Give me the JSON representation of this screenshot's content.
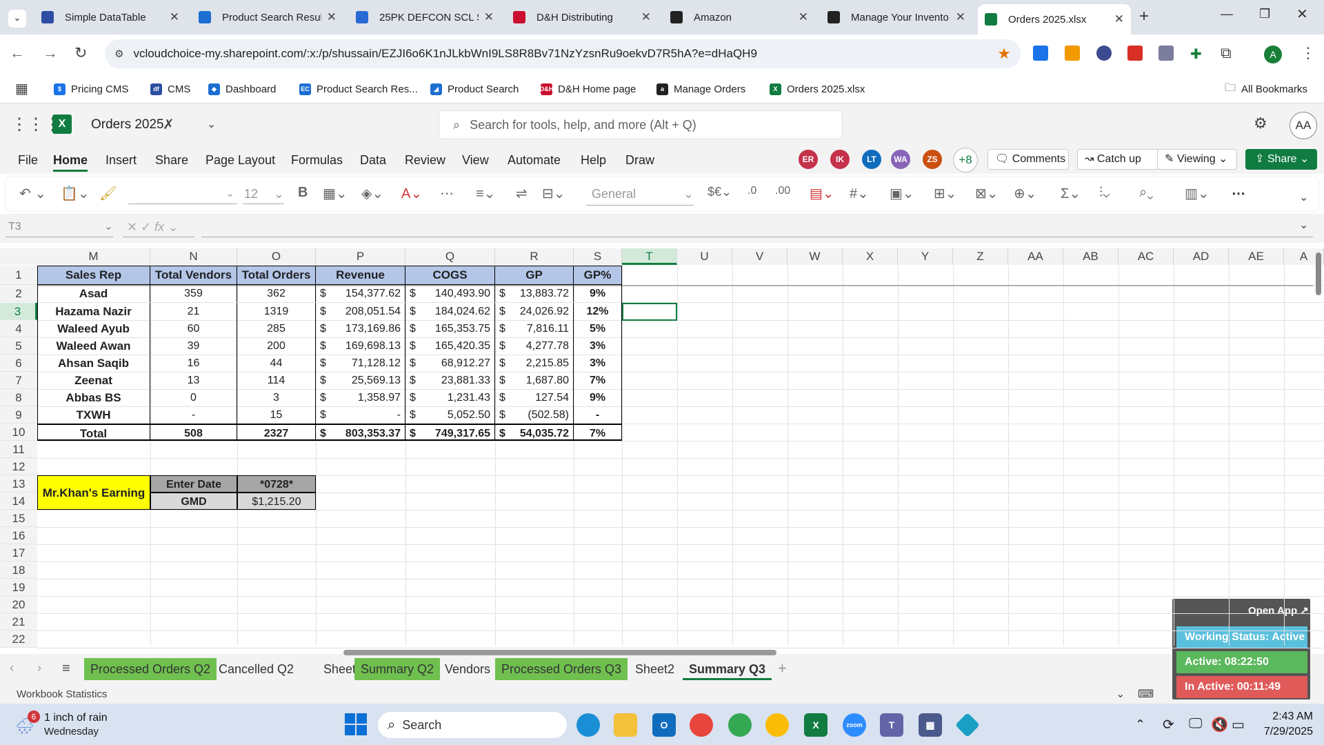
{
  "browser": {
    "tabs": [
      {
        "title": "Simple DataTable",
        "icon": "datatable-icon",
        "color": "#2c4fa3"
      },
      {
        "title": "Product Search Resul",
        "icon": "ec-icon",
        "color": "#1c6fd1"
      },
      {
        "title": "25PK DEFCON SCL SL",
        "icon": "defcon-icon",
        "color": "#2a6ad4"
      },
      {
        "title": "D&H Distributing",
        "icon": "dh-icon",
        "color": "#c8102e"
      },
      {
        "title": "Amazon",
        "icon": "amazon-icon",
        "color": "#222222"
      },
      {
        "title": "Manage Your Invento",
        "icon": "amazon-icon",
        "color": "#222222"
      },
      {
        "title": "Orders 2025.xlsx",
        "icon": "excel-icon",
        "color": "#107c41"
      }
    ],
    "url": "vcloudchoice-my.sharepoint.com/:x:/p/shussain/EZJI6o6K1nJLkbWnI9LS8R8Bv71NzYzsnRu9oekvD7R5hA?e=dHaQH9",
    "bookmarks": [
      {
        "label": "Pricing CMS",
        "color": "#1a73e8",
        "glyph": "$"
      },
      {
        "label": "CMS",
        "color": "#2c4fa3",
        "glyph": "df"
      },
      {
        "label": "Dashboard",
        "color": "#1c6fd1",
        "glyph": "◆"
      },
      {
        "label": "Product Search Res...",
        "color": "#1c6fd1",
        "glyph": "EC"
      },
      {
        "label": "Product Search",
        "color": "#1c6fd1",
        "glyph": "◢"
      },
      {
        "label": "D&H Home page",
        "color": "#c8102e",
        "glyph": "D&H"
      },
      {
        "label": "Manage Orders",
        "color": "#222222",
        "glyph": "a"
      },
      {
        "label": "Orders 2025.xlsx",
        "color": "#107c41",
        "glyph": "X"
      }
    ],
    "all_bookmarks": "All Bookmarks",
    "profile": "A"
  },
  "excel": {
    "doc_title": "Orders 2025",
    "search_placeholder": "Search for tools, help, and more (Alt + Q)",
    "user_initials": "AA",
    "menu": [
      "File",
      "Home",
      "Insert",
      "Share",
      "Page Layout",
      "Formulas",
      "Data",
      "Review",
      "View",
      "Automate",
      "Help",
      "Draw"
    ],
    "active_menu": "Home",
    "collaborators": [
      {
        "initials": "ER",
        "color": "#c4314b"
      },
      {
        "initials": "IK",
        "color": "#c4314b"
      },
      {
        "initials": "LT",
        "color": "#0f6cbd"
      },
      {
        "initials": "WA",
        "color": "#8764b8"
      },
      {
        "initials": "ZS",
        "color": "#ca5010"
      }
    ],
    "more_collaborators": "+8",
    "comments_label": "Comments",
    "catchup_label": "Catch up",
    "viewing_label": "Viewing",
    "share_label": "Share",
    "font_size": "12",
    "number_format": "General",
    "name_box": "T3",
    "sheet_columns": [
      "M",
      "N",
      "O",
      "P",
      "Q",
      "R",
      "S",
      "T",
      "U",
      "V",
      "W",
      "X",
      "Y",
      "Z",
      "AA",
      "AB",
      "AC",
      "AD",
      "AE",
      "A"
    ],
    "row_numbers": [
      "1",
      "2",
      "3",
      "4",
      "5",
      "6",
      "7",
      "8",
      "9",
      "10",
      "11",
      "12",
      "13",
      "14",
      "15",
      "16",
      "17",
      "18",
      "19",
      "20",
      "21",
      "22"
    ],
    "table": {
      "headers": [
        "Sales Rep",
        "Total Vendors",
        "Total Orders",
        "Revenue",
        "COGS",
        "GP",
        "GP%"
      ],
      "rows": [
        [
          "Asad",
          "359",
          "362",
          "154,377.62",
          "140,493.90",
          "13,883.72",
          "9%"
        ],
        [
          "Hazama Nazir",
          "21",
          "1319",
          "208,051.54",
          "184,024.62",
          "24,026.92",
          "12%"
        ],
        [
          "Waleed Ayub",
          "60",
          "285",
          "173,169.86",
          "165,353.75",
          "7,816.11",
          "5%"
        ],
        [
          "Waleed Awan",
          "39",
          "200",
          "169,698.13",
          "165,420.35",
          "4,277.78",
          "3%"
        ],
        [
          "Ahsan Saqib",
          "16",
          "44",
          "71,128.12",
          "68,912.27",
          "2,215.85",
          "3%"
        ],
        [
          "Zeenat",
          "13",
          "114",
          "25,569.13",
          "23,881.33",
          "1,687.80",
          "7%"
        ],
        [
          "Abbas BS",
          "0",
          "3",
          "1,358.97",
          "1,231.43",
          "127.54",
          "9%"
        ],
        [
          "TXWH",
          "-",
          "15",
          "-",
          "5,052.50",
          "(502.58)",
          "-"
        ]
      ],
      "total": [
        "Total",
        "508",
        "2327",
        "803,353.37",
        "749,317.65",
        "54,035.72",
        "7%"
      ],
      "currency_symbol": "$"
    },
    "earnings": {
      "label": "Mr.Khan's Earning",
      "date_label": "Enter Date",
      "date_value": "*0728*",
      "gmd_label": "GMD",
      "gmd_value": "$1,215.20"
    },
    "sheet_tabs": [
      {
        "label": "Processed Orders Q2",
        "color": "#70c050"
      },
      {
        "label": "Cancelled Q2",
        "color": ""
      },
      {
        "label": "Sheet1",
        "color": ""
      },
      {
        "label": "Summary Q2",
        "color": "#70c050"
      },
      {
        "label": "Vendors",
        "color": ""
      },
      {
        "label": "Processed Orders Q3",
        "color": "#70c050"
      },
      {
        "label": "Sheet2",
        "color": ""
      },
      {
        "label": "Summary Q3",
        "color": "",
        "active": true
      }
    ],
    "status_left": "Workbook Statistics"
  },
  "widget": {
    "open_app": "Open App ↗",
    "working_status": "Working Status: Active",
    "active_time": "Active: 08:22:50",
    "inactive_time": "In Active: 00:11:49"
  },
  "taskbar": {
    "weather_badge": "6",
    "weather_line1": "1 inch of rain",
    "weather_line2": "Wednesday",
    "search_label": "Search",
    "time": "2:43 AM",
    "date": "7/29/2025"
  }
}
